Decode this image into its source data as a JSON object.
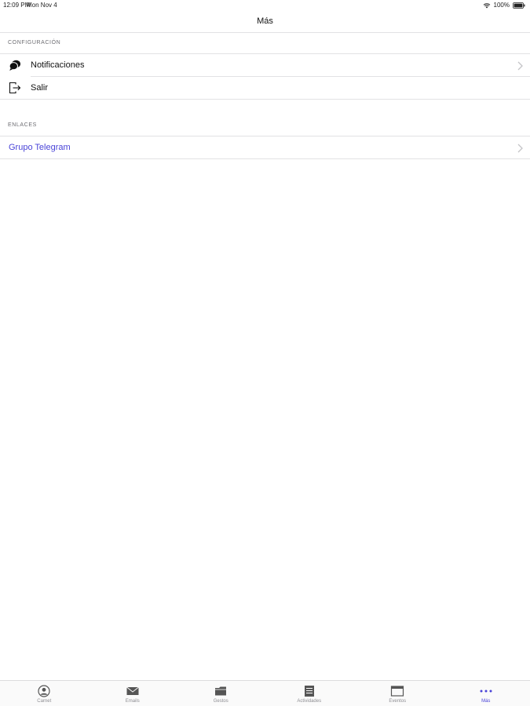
{
  "status_bar": {
    "time": "12:09 PM",
    "date": "Mon Nov 4",
    "battery": "100%"
  },
  "nav": {
    "title": "Más"
  },
  "sections": [
    {
      "header": "CONFIGURACIÓN",
      "rows": [
        {
          "label": "Notificaciones",
          "icon": "chat-bubbles-icon",
          "chevron": true
        },
        {
          "label": "Salir",
          "icon": "logout-icon",
          "chevron": false
        }
      ]
    },
    {
      "header": "ENLACES",
      "rows": [
        {
          "label": "Grupo Telegram",
          "chevron": true,
          "color": "#4a44d8"
        }
      ]
    }
  ],
  "tab_bar": {
    "tabs": [
      {
        "label": "Carnet",
        "icon": "person-circle-icon",
        "active": false
      },
      {
        "label": "Emails",
        "icon": "envelope-icon",
        "active": false
      },
      {
        "label": "Gestos",
        "icon": "folder-icon",
        "active": false
      },
      {
        "label": "Actividades",
        "icon": "list-icon",
        "active": false
      },
      {
        "label": "Eventos",
        "icon": "calendar-icon",
        "active": false
      },
      {
        "label": "Más",
        "icon": "more-dots-icon",
        "active": true
      }
    ],
    "active_color": "#4a44d8",
    "inactive_color": "#8e8e93"
  }
}
